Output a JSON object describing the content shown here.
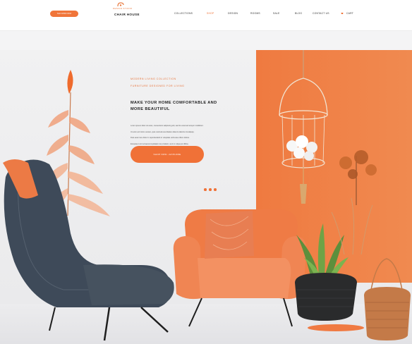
{
  "header": {
    "pill_label": "SHOWROOM",
    "logo": {
      "tagline": "DESIGN STUDIO",
      "name": "CHAIR HOUSE"
    },
    "nav": [
      {
        "label": "COLLECTIONS"
      },
      {
        "label": "SHOP",
        "active": true
      },
      {
        "label": "DESIGN"
      },
      {
        "label": "ROOMS"
      },
      {
        "label": "SALE"
      },
      {
        "label": "BLOG"
      },
      {
        "label": "CONTACT US"
      },
      {
        "label": "CART"
      }
    ],
    "accent_color": "#f0753a"
  },
  "hero": {
    "eyebrow": "MODERN LIVING COLLECTION",
    "subhead": "FURNITURE DESIGNED FOR LIVING",
    "headline": "MAKE YOUR HOME COMFORTABLE AND MORE BEAUTIFUL",
    "body_lines": [
      "Lorem ipsum dolor sit amet, consectetur adipiscing elit, sed do eiusmod tempor incididunt.",
      "Ut enim ad minim veniam, quis nostrud exercitation ullamco laboris nisi aliquip.",
      "Duis aute irure dolor in reprehenderit in voluptate velit esse cillum dolore.",
      "Excepteur sint occaecat cupidatat non proident, sunt in culpa qui officia."
    ],
    "cta_label": "SHOP NOW • EXPLORE",
    "slider_count": 3,
    "slider_active": 1,
    "colors": {
      "orange": "#f07137",
      "chair_dark": "#3f4b5a"
    }
  }
}
